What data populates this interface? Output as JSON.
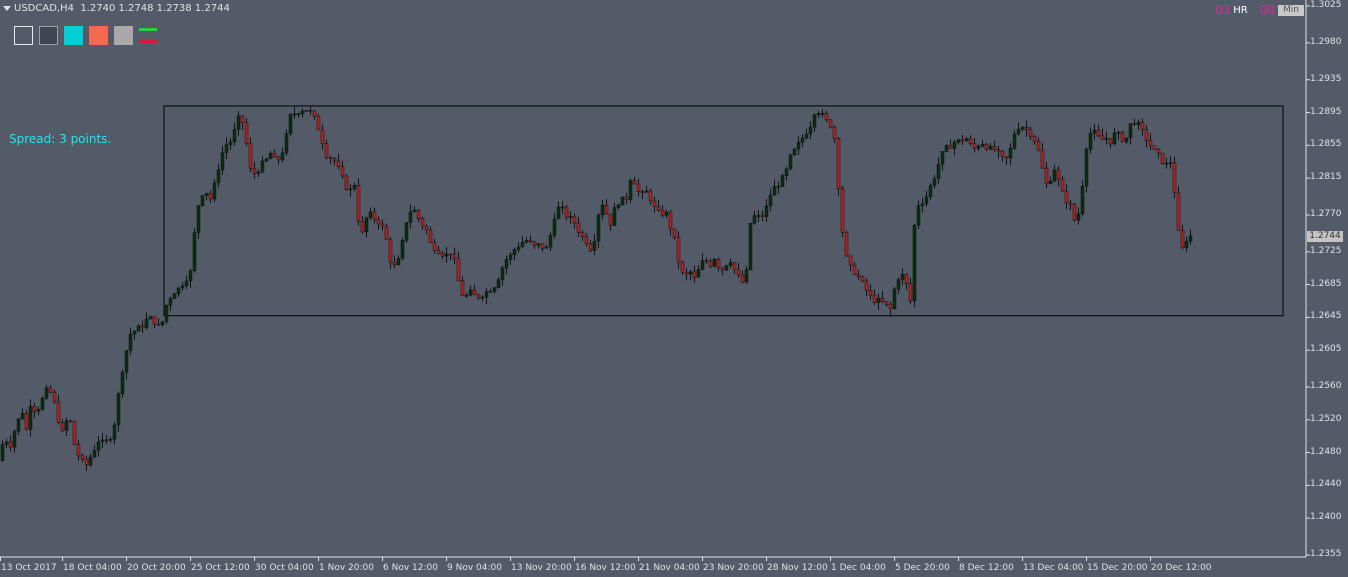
{
  "header": {
    "symbol": "USDCAD,H4",
    "ohlc": "1.2740 1.2748 1.2738 1.2744"
  },
  "spread_text": "Spread: 3 points.",
  "widget": {
    "left_num": "03",
    "hr_label": "HR",
    "right_num": "00",
    "min_label": "Min"
  },
  "colors": {
    "background": "#525b67",
    "axis": "#dfe3e8",
    "bull_body": "#0b2e12",
    "bear_body": "#b02322",
    "wick": "#111111",
    "box": "#000000",
    "spread": "#22e6ee"
  },
  "swatches": [
    "hollow",
    "dark",
    "cyan",
    "red",
    "gray",
    "lines"
  ],
  "current_price": "1.2744",
  "chart_data": {
    "type": "candlestick",
    "title": "",
    "symbol": "USDCAD",
    "timeframe": "H4",
    "price_ticks": [
      "1.3025",
      "1.2980",
      "1.2935",
      "1.2895",
      "1.2855",
      "1.2815",
      "1.2770",
      "1.2725",
      "1.2685",
      "1.2645",
      "1.2605",
      "1.2560",
      "1.2520",
      "1.2480",
      "1.2440",
      "1.2400",
      "1.2355"
    ],
    "time_ticks": [
      "13 Oct 2017",
      "18 Oct 04:00",
      "20 Oct 20:00",
      "25 Oct 12:00",
      "30 Oct 04:00",
      "1 Nov 20:00",
      "6 Nov 12:00",
      "9 Nov 04:00",
      "13 Nov 20:00",
      "16 Nov 12:00",
      "21 Nov 04:00",
      "23 Nov 20:00",
      "28 Nov 12:00",
      "1 Dec 04:00",
      "5 Dec 20:00",
      "8 Dec 12:00",
      "13 Dec 04:00",
      "15 Dec 20:00",
      "20 Dec 12:00"
    ],
    "ylim": [
      1.2355,
      1.3025
    ],
    "range_box": {
      "high": 1.2903,
      "low": 1.2647
    },
    "close_path": [
      [
        0,
        1.247
      ],
      [
        4,
        1.251
      ],
      [
        8,
        1.248
      ],
      [
        12,
        1.25
      ],
      [
        18,
        1.252
      ],
      [
        22,
        1.253
      ],
      [
        25,
        1.25
      ],
      [
        30,
        1.254
      ],
      [
        36,
        1.253
      ],
      [
        42,
        1.2545
      ],
      [
        48,
        1.256
      ],
      [
        54,
        1.254
      ],
      [
        58,
        1.252
      ],
      [
        63,
        1.25
      ],
      [
        68,
        1.253
      ],
      [
        74,
        1.249
      ],
      [
        80,
        1.247
      ],
      [
        86,
        1.2465
      ],
      [
        92,
        1.248
      ],
      [
        98,
        1.2495
      ],
      [
        104,
        1.249
      ],
      [
        110,
        1.25
      ],
      [
        115,
        1.252
      ],
      [
        120,
        1.257
      ],
      [
        125,
        1.26
      ],
      [
        130,
        1.2625
      ],
      [
        136,
        1.263
      ],
      [
        142,
        1.2635
      ],
      [
        148,
        1.2645
      ],
      [
        154,
        1.264
      ],
      [
        160,
        1.263
      ],
      [
        166,
        1.266
      ],
      [
        172,
        1.2675
      ],
      [
        178,
        1.268
      ],
      [
        184,
        1.269
      ],
      [
        190,
        1.27
      ],
      [
        196,
        1.277
      ],
      [
        200,
        1.2795
      ],
      [
        205,
        1.28
      ],
      [
        210,
        1.279
      ],
      [
        215,
        1.281
      ],
      [
        220,
        1.284
      ],
      [
        225,
        1.2855
      ],
      [
        230,
        1.286
      ],
      [
        235,
        1.2875
      ],
      [
        240,
        1.2895
      ],
      [
        245,
        1.2865
      ],
      [
        250,
        1.2825
      ],
      [
        255,
        1.282
      ],
      [
        260,
        1.283
      ],
      [
        265,
        1.2835
      ],
      [
        270,
        1.2845
      ],
      [
        275,
        1.2835
      ],
      [
        280,
        1.284
      ],
      [
        285,
        1.286
      ],
      [
        290,
        1.289
      ],
      [
        295,
        1.2895
      ],
      [
        300,
        1.2898
      ],
      [
        305,
        1.29
      ],
      [
        310,
        1.2895
      ],
      [
        315,
        1.2885
      ],
      [
        320,
        1.287
      ],
      [
        325,
        1.2845
      ],
      [
        330,
        1.284
      ],
      [
        335,
        1.2835
      ],
      [
        340,
        1.282
      ],
      [
        345,
        1.2805
      ],
      [
        350,
        1.28
      ],
      [
        355,
        1.281
      ],
      [
        360,
        1.2735
      ],
      [
        365,
        1.2765
      ],
      [
        370,
        1.277
      ],
      [
        375,
        1.2765
      ],
      [
        380,
        1.276
      ],
      [
        385,
        1.2745
      ],
      [
        390,
        1.2715
      ],
      [
        395,
        1.2705
      ],
      [
        400,
        1.272
      ],
      [
        405,
        1.276
      ],
      [
        410,
        1.2775
      ],
      [
        415,
        1.2775
      ],
      [
        420,
        1.276
      ],
      [
        425,
        1.2755
      ],
      [
        430,
        1.2735
      ],
      [
        435,
        1.273
      ],
      [
        440,
        1.2725
      ],
      [
        445,
        1.272
      ],
      [
        450,
        1.2725
      ],
      [
        455,
        1.271
      ],
      [
        460,
        1.2675
      ],
      [
        465,
        1.267
      ],
      [
        470,
        1.2675
      ],
      [
        475,
        1.267
      ],
      [
        480,
        1.2672
      ],
      [
        485,
        1.2675
      ],
      [
        490,
        1.268
      ],
      [
        495,
        1.2685
      ],
      [
        500,
        1.27
      ],
      [
        505,
        1.2715
      ],
      [
        510,
        1.272
      ],
      [
        515,
        1.273
      ],
      [
        520,
        1.2735
      ],
      [
        525,
        1.274
      ],
      [
        530,
        1.2735
      ],
      [
        535,
        1.273
      ],
      [
        540,
        1.2735
      ],
      [
        545,
        1.2725
      ],
      [
        550,
        1.2745
      ],
      [
        555,
        1.2775
      ],
      [
        560,
        1.278
      ],
      [
        565,
        1.277
      ],
      [
        570,
        1.2765
      ],
      [
        575,
        1.276
      ],
      [
        580,
        1.2745
      ],
      [
        585,
        1.274
      ],
      [
        590,
        1.273
      ],
      [
        595,
        1.2745
      ],
      [
        600,
        1.279
      ],
      [
        605,
        1.2775
      ],
      [
        610,
        1.276
      ],
      [
        615,
        1.278
      ],
      [
        620,
        1.279
      ],
      [
        625,
        1.2785
      ],
      [
        630,
        1.2815
      ],
      [
        635,
        1.281
      ],
      [
        640,
        1.279
      ],
      [
        645,
        1.28
      ],
      [
        650,
        1.279
      ],
      [
        655,
        1.2775
      ],
      [
        660,
        1.277
      ],
      [
        665,
        1.2775
      ],
      [
        670,
        1.2755
      ],
      [
        675,
        1.2735
      ],
      [
        680,
        1.27
      ],
      [
        685,
        1.2695
      ],
      [
        690,
        1.27
      ],
      [
        695,
        1.269
      ],
      [
        700,
        1.271
      ],
      [
        705,
        1.2715
      ],
      [
        710,
        1.271
      ],
      [
        715,
        1.272
      ],
      [
        720,
        1.27
      ],
      [
        725,
        1.271
      ],
      [
        730,
        1.2715
      ],
      [
        735,
        1.27
      ],
      [
        740,
        1.269
      ],
      [
        745,
        1.2685
      ],
      [
        750,
        1.276
      ],
      [
        755,
        1.277
      ],
      [
        760,
        1.2765
      ],
      [
        765,
        1.2775
      ],
      [
        770,
        1.2795
      ],
      [
        775,
        1.2805
      ],
      [
        780,
        1.281
      ],
      [
        785,
        1.282
      ],
      [
        790,
        1.284
      ],
      [
        795,
        1.285
      ],
      [
        800,
        1.286
      ],
      [
        805,
        1.287
      ],
      [
        810,
        1.288
      ],
      [
        815,
        1.29
      ],
      [
        820,
        1.2895
      ],
      [
        825,
        1.2885
      ],
      [
        830,
        1.288
      ],
      [
        835,
        1.286
      ],
      [
        840,
        1.277
      ],
      [
        845,
        1.272
      ],
      [
        850,
        1.2705
      ],
      [
        855,
        1.27
      ],
      [
        860,
        1.269
      ],
      [
        865,
        1.268
      ],
      [
        870,
        1.267
      ],
      [
        875,
        1.2665
      ],
      [
        880,
        1.2665
      ],
      [
        885,
        1.266
      ],
      [
        890,
        1.2655
      ],
      [
        895,
        1.2685
      ],
      [
        900,
        1.27
      ],
      [
        905,
        1.269
      ],
      [
        910,
        1.2665
      ],
      [
        915,
        1.278
      ],
      [
        920,
        1.2785
      ],
      [
        925,
        1.279
      ],
      [
        930,
        1.2805
      ],
      [
        935,
        1.282
      ],
      [
        940,
        1.284
      ],
      [
        945,
        1.285
      ],
      [
        950,
        1.2855
      ],
      [
        955,
        1.286
      ],
      [
        960,
        1.286
      ],
      [
        965,
        1.2865
      ],
      [
        970,
        1.2855
      ],
      [
        975,
        1.285
      ],
      [
        980,
        1.286
      ],
      [
        985,
        1.2855
      ],
      [
        990,
        1.285
      ],
      [
        995,
        1.285
      ],
      [
        1000,
        1.284
      ],
      [
        1005,
        1.2835
      ],
      [
        1010,
        1.285
      ],
      [
        1015,
        1.2875
      ],
      [
        1020,
        1.288
      ],
      [
        1025,
        1.2875
      ],
      [
        1030,
        1.287
      ],
      [
        1035,
        1.286
      ],
      [
        1040,
        1.284
      ],
      [
        1045,
        1.2805
      ],
      [
        1050,
        1.2815
      ],
      [
        1055,
        1.283
      ],
      [
        1060,
        1.28
      ],
      [
        1065,
        1.279
      ],
      [
        1070,
        1.278
      ],
      [
        1075,
        1.276
      ],
      [
        1080,
        1.278
      ],
      [
        1085,
        1.285
      ],
      [
        1090,
        1.287
      ],
      [
        1095,
        1.287
      ],
      [
        1100,
        1.286
      ],
      [
        1105,
        1.2865
      ],
      [
        1110,
        1.286
      ],
      [
        1115,
        1.287
      ],
      [
        1120,
        1.2865
      ],
      [
        1125,
        1.286
      ],
      [
        1130,
        1.288
      ],
      [
        1135,
        1.2885
      ],
      [
        1140,
        1.2875
      ],
      [
        1145,
        1.2865
      ],
      [
        1150,
        1.2855
      ],
      [
        1155,
        1.2845
      ],
      [
        1160,
        1.284
      ],
      [
        1165,
        1.283
      ],
      [
        1170,
        1.2835
      ],
      [
        1175,
        1.279
      ],
      [
        1180,
        1.272
      ],
      [
        1185,
        1.274
      ],
      [
        1190,
        1.2744
      ]
    ]
  }
}
